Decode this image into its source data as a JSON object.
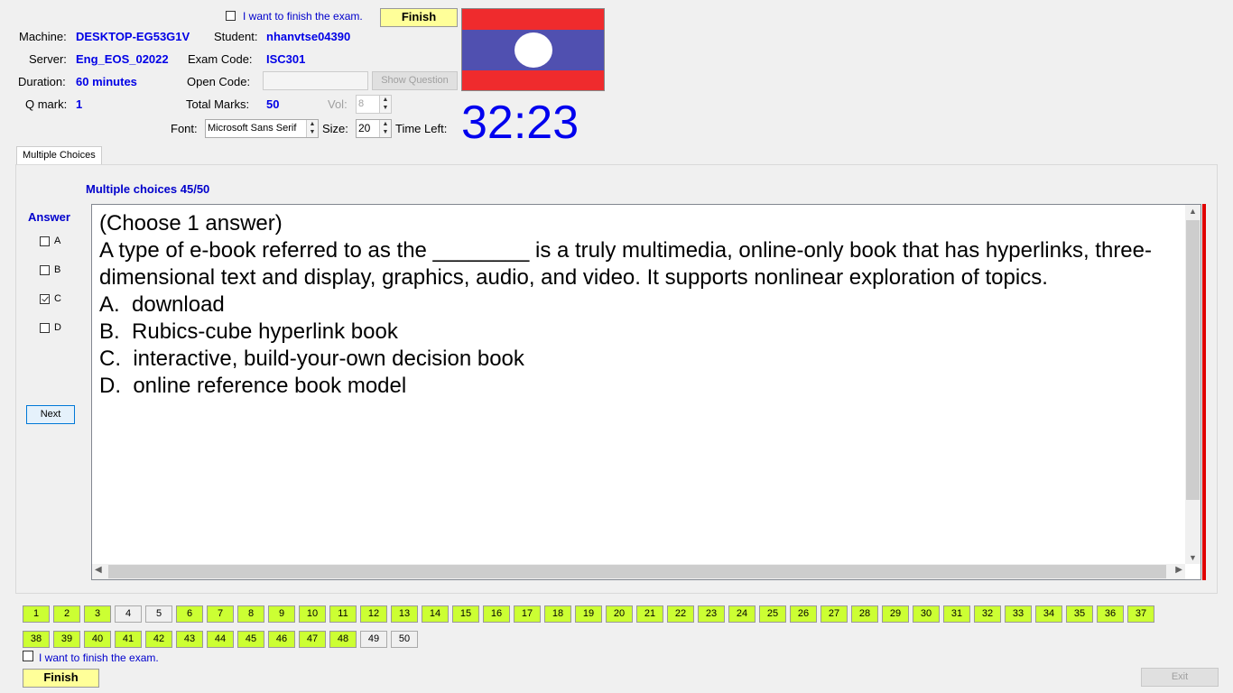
{
  "header": {
    "finish_checkbox_label": "I want to finish the exam.",
    "finish_button": "Finish",
    "machine_label": "Machine:",
    "machine_value": "DESKTOP-EG53G1V",
    "student_label": "Student:",
    "student_value": "nhanvtse04390",
    "server_label": "Server:",
    "server_value": "Eng_EOS_02022",
    "exam_code_label": "Exam Code:",
    "exam_code_value": "ISC301",
    "duration_label": "Duration:",
    "duration_value": "60 minutes",
    "open_code_label": "Open Code:",
    "open_code_value": "",
    "show_question_button": "Show Question",
    "qmark_label": "Q mark:",
    "qmark_value": "1",
    "total_marks_label": "Total Marks:",
    "total_marks_value": "50",
    "vol_label": "Vol:",
    "vol_value": "8",
    "font_label": "Font:",
    "font_value": "Microsoft Sans Serif",
    "size_label": "Size:",
    "size_value": "20",
    "time_left_label": "Time Left:",
    "time_left_value": "32:23",
    "flag_colors": {
      "red": "#ef2b2d",
      "blue": "#5050b0",
      "white": "#ffffff"
    }
  },
  "tabs": [
    {
      "label": "Multiple Choices"
    }
  ],
  "question": {
    "progress": "Multiple choices 45/50",
    "answer_label": "Answer",
    "options": [
      {
        "letter": "A",
        "checked": false
      },
      {
        "letter": "B",
        "checked": false
      },
      {
        "letter": "C",
        "checked": true
      },
      {
        "letter": "D",
        "checked": false
      }
    ],
    "next_button": "Next",
    "lines": [
      "(Choose 1 answer)",
      "",
      "A type of e-book referred to as the ________ is a truly multimedia, online-only book that has hyperlinks, three-dimensional text and display, graphics, audio, and video. It supports nonlinear exploration of topics.",
      "",
      "A.  download",
      "",
      "B.  Rubics-cube hyperlink book",
      "",
      "C.  interactive, build-your-own decision book",
      "",
      "D.  online reference book model"
    ]
  },
  "navigation": {
    "questions": [
      {
        "n": "1",
        "answered": true
      },
      {
        "n": "2",
        "answered": true
      },
      {
        "n": "3",
        "answered": true
      },
      {
        "n": "4",
        "answered": false
      },
      {
        "n": "5",
        "answered": false
      },
      {
        "n": "6",
        "answered": true
      },
      {
        "n": "7",
        "answered": true
      },
      {
        "n": "8",
        "answered": true
      },
      {
        "n": "9",
        "answered": true
      },
      {
        "n": "10",
        "answered": true
      },
      {
        "n": "11",
        "answered": true
      },
      {
        "n": "12",
        "answered": true
      },
      {
        "n": "13",
        "answered": true
      },
      {
        "n": "14",
        "answered": true
      },
      {
        "n": "15",
        "answered": true
      },
      {
        "n": "16",
        "answered": true
      },
      {
        "n": "17",
        "answered": true
      },
      {
        "n": "18",
        "answered": true
      },
      {
        "n": "19",
        "answered": true
      },
      {
        "n": "20",
        "answered": true
      },
      {
        "n": "21",
        "answered": true
      },
      {
        "n": "22",
        "answered": true
      },
      {
        "n": "23",
        "answered": true
      },
      {
        "n": "24",
        "answered": true
      },
      {
        "n": "25",
        "answered": true
      },
      {
        "n": "26",
        "answered": true
      },
      {
        "n": "27",
        "answered": true
      },
      {
        "n": "28",
        "answered": true
      },
      {
        "n": "29",
        "answered": true
      },
      {
        "n": "30",
        "answered": true
      },
      {
        "n": "31",
        "answered": true
      },
      {
        "n": "32",
        "answered": true
      },
      {
        "n": "33",
        "answered": true
      },
      {
        "n": "34",
        "answered": true
      },
      {
        "n": "35",
        "answered": true
      },
      {
        "n": "36",
        "answered": true
      },
      {
        "n": "37",
        "answered": true
      },
      {
        "n": "38",
        "answered": true
      },
      {
        "n": "39",
        "answered": true
      },
      {
        "n": "40",
        "answered": true
      },
      {
        "n": "41",
        "answered": true
      },
      {
        "n": "42",
        "answered": true
      },
      {
        "n": "43",
        "answered": true
      },
      {
        "n": "44",
        "answered": true
      },
      {
        "n": "45",
        "answered": true
      },
      {
        "n": "46",
        "answered": true
      },
      {
        "n": "47",
        "answered": true
      },
      {
        "n": "48",
        "answered": true
      },
      {
        "n": "49",
        "answered": false
      },
      {
        "n": "50",
        "answered": false
      }
    ]
  },
  "footer": {
    "finish_checkbox_label": "I want to finish the exam.",
    "finish_button": "Finish",
    "exit_button": "Exit"
  }
}
